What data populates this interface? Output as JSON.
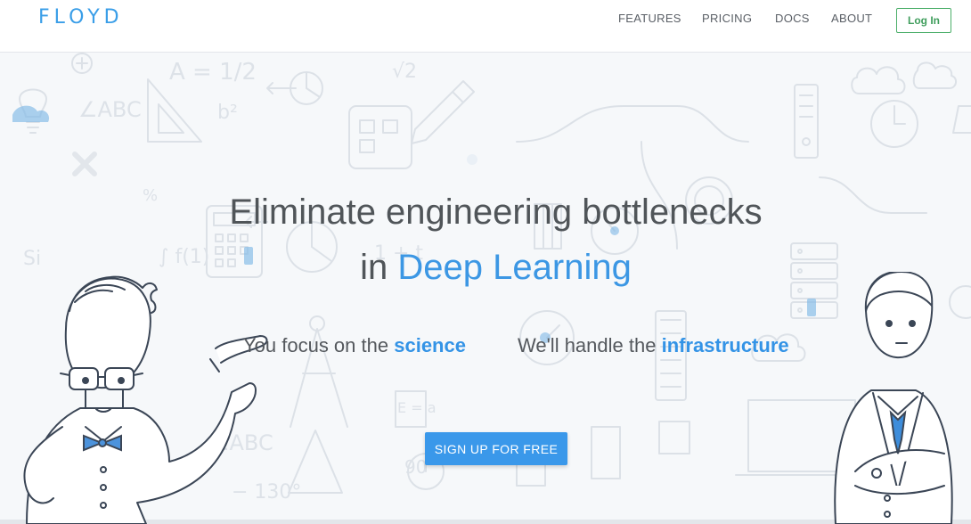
{
  "brand": {
    "logo": "FLOYD"
  },
  "nav": {
    "items": [
      {
        "label": "FEATURES"
      },
      {
        "label": "PRICING"
      },
      {
        "label": "DOCS"
      },
      {
        "label": "ABOUT"
      }
    ],
    "login_label": "Log In"
  },
  "hero": {
    "headline_line1": "Eliminate engineering bottlenecks",
    "headline_line2_prefix": "in",
    "headline_line2_accent": "Deep Learning",
    "tagline_left_prefix": "You focus on the",
    "tagline_left_strong": "science",
    "tagline_right_prefix": "We'll handle the",
    "tagline_right_strong": "infrastructure",
    "cta_label": "SIGN UP FOR FREE"
  },
  "background_doodles": {
    "text_marks": [
      "A = 1/2",
      "√2",
      "∠ABC",
      "b²",
      "Si",
      "∫ f(1)",
      "1 + t",
      "%",
      "∠ABC",
      "− 130°",
      "90",
      "E = a"
    ]
  },
  "colors": {
    "brand_blue": "#3a9ee8",
    "accent_blue": "#3c97e4",
    "cta_blue": "#3a98ea",
    "login_green": "#4caf6a",
    "text_gray": "#505559"
  }
}
